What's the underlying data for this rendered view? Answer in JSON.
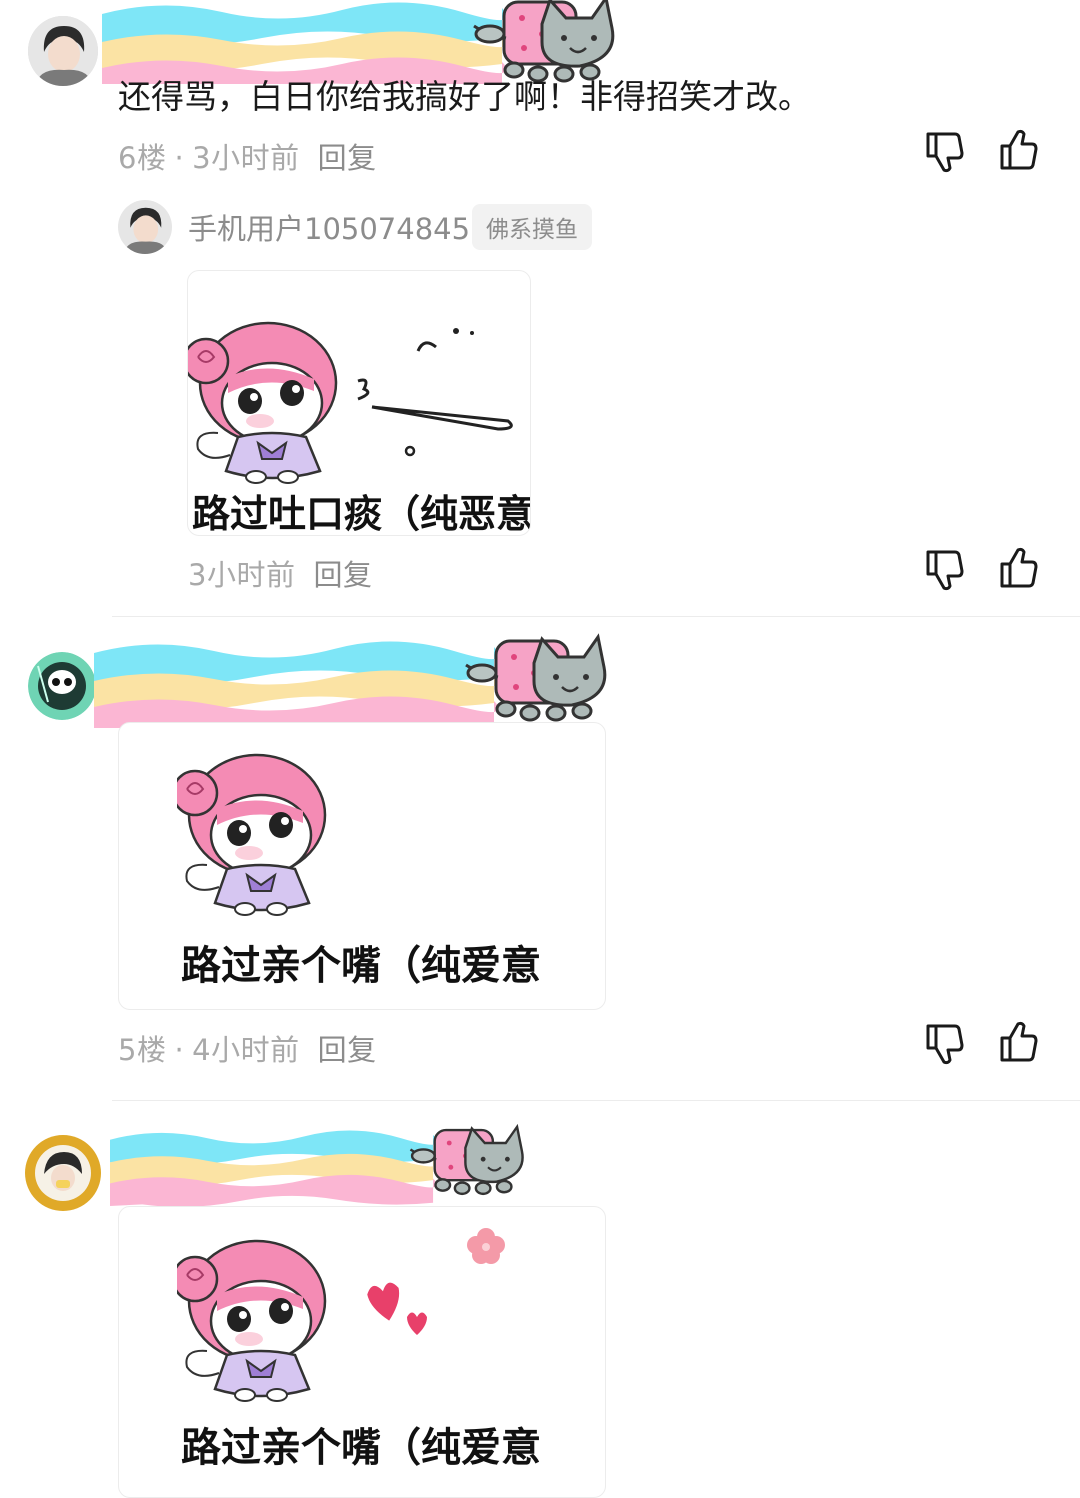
{
  "comments": [
    {
      "avatar": "avatar-boy-gray-hoodie",
      "text": "还得骂，白日你给我搞好了啊！非得招笑才改。",
      "floor": "6楼",
      "time": "3小时前",
      "reply": "回复",
      "reply_item": {
        "avatar": "avatar-boy-gray-hoodie",
        "username": "手机用户105074845",
        "badge": "佛系摸鱼",
        "sticker_caption": "路过吐口痰（纯恶意",
        "time": "3小时前",
        "reply": "回复"
      }
    },
    {
      "avatar": "avatar-panda-reaper",
      "sticker_caption": "路过亲个嘴（纯爱意",
      "floor": "5楼",
      "time": "4小时前",
      "reply": "回复"
    },
    {
      "avatar": "avatar-girl-gold-frame",
      "sticker_caption": "路过亲个嘴（纯爱意"
    }
  ],
  "icons": {
    "dislike": "thumbs-down-icon",
    "like": "thumbs-up-icon"
  },
  "colors": {
    "meta_gray": "#a9a9a9",
    "rainbow_cyan": "#7ee6f7",
    "rainbow_yellow": "#fbe3a4",
    "rainbow_pink": "#fbb6d3"
  }
}
